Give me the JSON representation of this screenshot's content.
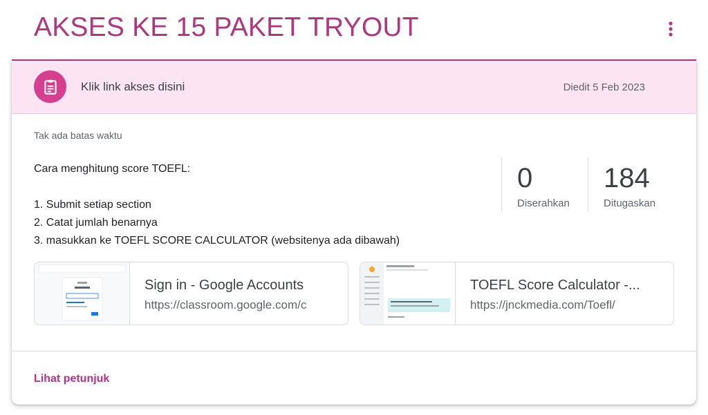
{
  "header": {
    "title": "AKSES KE 15 PAKET TRYOUT",
    "more_icon": "more-vert-icon"
  },
  "colors": {
    "accent": "#b2357f",
    "banner_bg": "#fce4f2",
    "icon_bg": "#d63e8e"
  },
  "banner": {
    "icon": "assignment-icon",
    "title": "Klik link akses disini",
    "date": "Diedit 5 Feb 2023"
  },
  "due": "Tak ada batas waktu",
  "description": [
    "Cara menghitung score TOEFL:",
    "",
    "1. Submit setiap section",
    "2. Catat jumlah benarnya",
    "3. masukkan ke TOEFL SCORE CALCULATOR (websitenya ada dibawah)"
  ],
  "stats": {
    "submitted": {
      "value": "0",
      "label": "Diserahkan"
    },
    "assigned": {
      "value": "184",
      "label": "Ditugaskan"
    }
  },
  "attachments": [
    {
      "title": "Sign in - Google Accounts",
      "url": "https://classroom.google.com/c"
    },
    {
      "title": "TOEFL Score Calculator -...",
      "url": "https://jnckmedia.com/Toefl/"
    }
  ],
  "footer": {
    "link": "Lihat petunjuk"
  }
}
